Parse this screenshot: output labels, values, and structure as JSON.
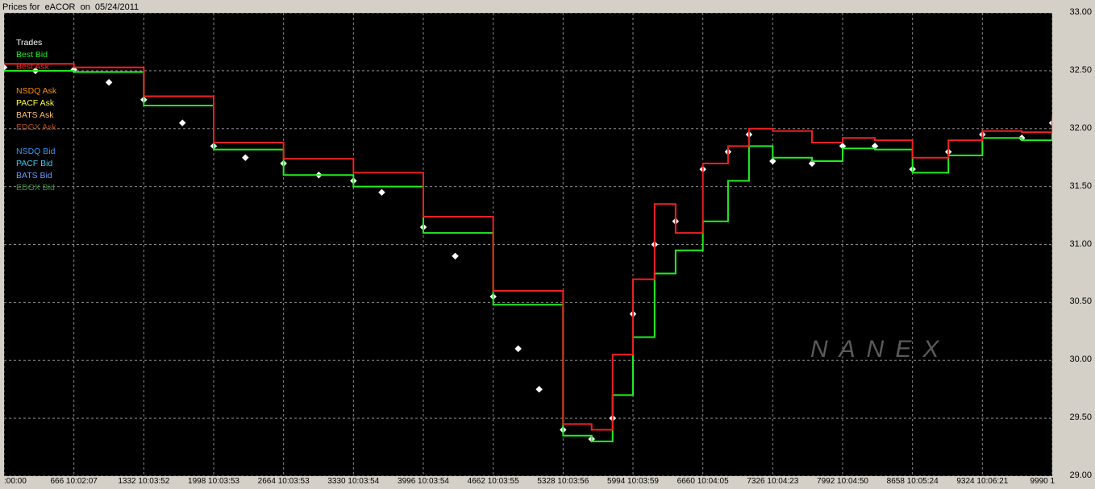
{
  "title": "Prices for  eACOR  on  05/24/2011",
  "watermark": "NANEX",
  "legend": [
    {
      "label": "Trades",
      "color": "#ffffff"
    },
    {
      "label": "Best Bid",
      "color": "#22ee22"
    },
    {
      "label": "Best Ask",
      "color": "#ee2222"
    },
    {
      "label": "",
      "color": "#000000"
    },
    {
      "label": "NSDQ Ask",
      "color": "#ff8c00"
    },
    {
      "label": "PACF Ask",
      "color": "#ffff33"
    },
    {
      "label": "BATS Ask",
      "color": "#ffbb66"
    },
    {
      "label": "EDGX Ask",
      "color": "#b44a1e"
    },
    {
      "label": "",
      "color": "#000000"
    },
    {
      "label": "NSDQ Bid",
      "color": "#3399ff"
    },
    {
      "label": "PACF Bid",
      "color": "#33ccee"
    },
    {
      "label": "BATS Bid",
      "color": "#6699ff"
    },
    {
      "label": "EDGX Bid",
      "color": "#339933"
    }
  ],
  "chart_data": {
    "type": "line",
    "title": "Prices for  eACOR  on  05/24/2011",
    "ylim": [
      29.0,
      33.0
    ],
    "y_ticks": [
      "33.00",
      "32.50",
      "32.00",
      "31.50",
      "31.00",
      "30.50",
      "30.00",
      "29.50",
      "29.00"
    ],
    "x_ticks": [
      ":00:00",
      "666 10:02:07",
      "1332 10:03:52",
      "1998 10:03:53",
      "2664 10:03:53",
      "3330 10:03:54",
      "3996 10:03:54",
      "4662 10:03:55",
      "5328 10:03:56",
      "5994 10:03:59",
      "6660 10:04:05",
      "7326 10:04:23",
      "7992 10:04:50",
      "8658 10:05:24",
      "9324 10:06:21",
      "9990 1"
    ],
    "x_tick_index": [
      0,
      666,
      1332,
      1998,
      2664,
      3330,
      3996,
      4662,
      5328,
      5994,
      6660,
      7326,
      7992,
      8658,
      9324,
      9990
    ],
    "xlim": [
      0,
      9990
    ],
    "grid": true,
    "legend_position": "top-left",
    "series": [
      {
        "name": "Trades",
        "color": "#ffffff",
        "x": [
          0,
          300,
          666,
          1000,
          1332,
          1700,
          1998,
          2300,
          2664,
          3000,
          3330,
          3600,
          3996,
          4300,
          4662,
          4900,
          5100,
          5328,
          5600,
          5800,
          5994,
          6200,
          6400,
          6660,
          6900,
          7100,
          7326,
          7700,
          7992,
          8300,
          8658,
          9000,
          9324,
          9700,
          9990
        ],
        "y": [
          32.53,
          32.5,
          32.51,
          32.4,
          32.25,
          32.05,
          31.85,
          31.75,
          31.7,
          31.6,
          31.55,
          31.45,
          31.15,
          30.9,
          30.55,
          30.1,
          29.75,
          29.4,
          29.32,
          29.5,
          30.4,
          31.0,
          31.2,
          31.65,
          31.8,
          31.95,
          31.72,
          31.7,
          31.85,
          31.85,
          31.65,
          31.8,
          31.95,
          31.92,
          32.05
        ]
      },
      {
        "name": "Best Bid",
        "color": "#22ee22",
        "x": [
          0,
          666,
          1332,
          1998,
          2664,
          3330,
          3996,
          4662,
          5328,
          5600,
          5800,
          5994,
          6200,
          6400,
          6660,
          6900,
          7100,
          7326,
          7700,
          7992,
          8300,
          8658,
          9000,
          9324,
          9700,
          9990
        ],
        "y": [
          32.5,
          32.49,
          32.2,
          31.82,
          31.6,
          31.5,
          31.1,
          30.48,
          29.35,
          29.3,
          29.7,
          30.2,
          30.75,
          30.95,
          31.2,
          31.55,
          31.85,
          31.75,
          31.72,
          31.83,
          31.82,
          31.62,
          31.77,
          31.92,
          31.9,
          32.0
        ]
      },
      {
        "name": "Best Ask",
        "color": "#ee2222",
        "x": [
          0,
          666,
          1332,
          1998,
          2664,
          3330,
          3996,
          4662,
          5328,
          5600,
          5800,
          5994,
          6200,
          6400,
          6660,
          6900,
          7100,
          7326,
          7700,
          7992,
          8300,
          8658,
          9000,
          9324,
          9700,
          9990
        ],
        "y": [
          32.56,
          32.53,
          32.28,
          31.88,
          31.74,
          31.62,
          31.24,
          30.6,
          29.45,
          29.4,
          30.05,
          30.7,
          31.35,
          31.1,
          31.7,
          31.85,
          32.0,
          31.98,
          31.88,
          31.92,
          31.9,
          31.75,
          31.9,
          31.98,
          31.97,
          32.1
        ]
      }
    ]
  }
}
